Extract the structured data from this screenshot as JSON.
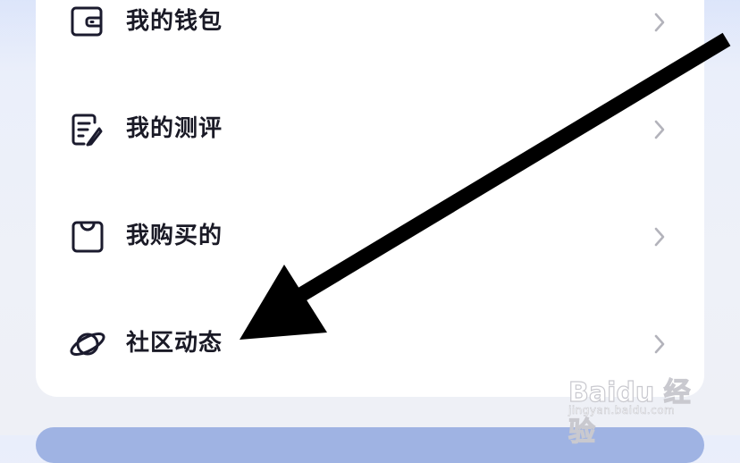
{
  "menu": {
    "items": [
      {
        "label": "我的钱包",
        "icon": "wallet-icon"
      },
      {
        "label": "我的测评",
        "icon": "notepad-pen-icon"
      },
      {
        "label": "我购买的",
        "icon": "shopping-bag-icon"
      },
      {
        "label": "社区动态",
        "icon": "planet-icon"
      }
    ],
    "chevron_icon": "chevron-right-icon"
  },
  "watermark": {
    "brand": "Baidu 经验",
    "domain": "jingyan.baidu.com"
  },
  "colors": {
    "icon_stroke": "#1b1b2e",
    "label_text": "#1a1a26",
    "chevron": "#b3b3bb",
    "card_bg": "#ffffff",
    "page_bg": "#eef1f8",
    "bottom_bar": "#9fb3e3",
    "arrow": "#000000"
  }
}
